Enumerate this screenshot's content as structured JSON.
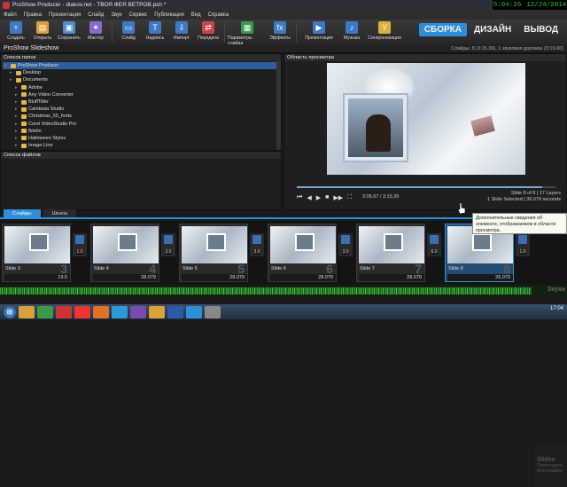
{
  "titlebar": {
    "title": "ProShow Producer - diakov.net - ТВОЯ ФЕЯ ВЕТРОВ.psh *"
  },
  "clock": {
    "time": "5:04:26",
    "date": "12/24/2014"
  },
  "menu": [
    "Файл",
    "Правка",
    "Презентация",
    "Слайд",
    "Звук",
    "Сервис",
    "Публикация",
    "Вид",
    "Справка"
  ],
  "toolbar": {
    "groups": [
      [
        {
          "label": "Создать",
          "icon": "new-icon",
          "color": "#3d79c4",
          "glyph": "+"
        },
        {
          "label": "Открыть",
          "icon": "open-icon",
          "color": "#d9a13a",
          "glyph": "▤"
        },
        {
          "label": "Сохранить",
          "icon": "save-icon",
          "color": "#4a8fd0",
          "glyph": "▣"
        },
        {
          "label": "Мастер",
          "icon": "wizard-icon",
          "color": "#8a6ad0",
          "glyph": "✦"
        }
      ],
      [
        {
          "label": "Слайд",
          "icon": "slide-icon",
          "color": "#3d79c4",
          "glyph": "▭"
        },
        {
          "label": "Надпись",
          "icon": "caption-icon",
          "color": "#3d79c4",
          "glyph": "T"
        },
        {
          "label": "Импорт",
          "icon": "import-icon",
          "color": "#3d79c4",
          "glyph": "⇩"
        },
        {
          "label": "Передача",
          "icon": "transfer-icon",
          "color": "#c44",
          "glyph": "⇄"
        }
      ],
      [
        {
          "label": "Параметры слайда",
          "icon": "slide-options-icon",
          "color": "#3a9a4a",
          "glyph": "▦"
        },
        {
          "label": "Эффекты",
          "icon": "effects-icon",
          "color": "#3d79c4",
          "glyph": "fx"
        }
      ],
      [
        {
          "label": "Презентация",
          "icon": "presentation-icon",
          "color": "#3d79c4",
          "glyph": "▶"
        },
        {
          "label": "Музыка",
          "icon": "music-icon",
          "color": "#3d79c4",
          "glyph": "♪"
        },
        {
          "label": "Синхронизация",
          "icon": "sync-icon",
          "color": "#d9b23a",
          "glyph": "Y"
        }
      ]
    ]
  },
  "modes": [
    "СБОРКА",
    "ДИЗАЙН",
    "ВЫВОД"
  ],
  "project": {
    "title": "ProShow Slideshow",
    "info": "Слайды: 8 (3:15.39), 1 звуковая дорожка (3:19.00)"
  },
  "folders": {
    "header": "Список папок",
    "items": [
      "ProShow Producer",
      "Desktop",
      "Documents",
      "Adobe",
      "Any Video Converter",
      "BluffTitler",
      "Camtasia Studio",
      "Christmas_55_fonts",
      "Corel VideoStudio Pro",
      "fbtoilo",
      "Halloween Styles",
      "Image-Line"
    ]
  },
  "files": {
    "header": "Список файлов"
  },
  "preview": {
    "header": "Область просмотра",
    "time": "3:05.67 / 3:15.39",
    "slide_info": "Slide 8 of 8  |  17 Layers",
    "slide_info2": "1 Slide Selected  |  39.079 seconds",
    "seek_progress": 0.95
  },
  "tabs": [
    "Слайды",
    "Шкала"
  ],
  "tooltip": "Дополнительные сведения об элементе, отображаемом в области просмотра.",
  "slides": [
    {
      "label": "Slide 3",
      "num": "3",
      "dur": "19.0",
      "trans": "1.0"
    },
    {
      "label": "Slide 4",
      "num": "4",
      "dur": "28.079",
      "trans": "3.0"
    },
    {
      "label": "Slide 5",
      "num": "5",
      "dur": "28.079",
      "trans": "3.0"
    },
    {
      "label": "Slide 6",
      "num": "6",
      "dur": "28.079",
      "trans": "3.0"
    },
    {
      "label": "Slide 7",
      "num": "7",
      "dur": "28.079",
      "trans": "6.0"
    },
    {
      "label": "Slide 8",
      "num": "8",
      "dur": "26.079",
      "trans": "1.0"
    }
  ],
  "slides_box": {
    "title": "Slides",
    "sub": "Перетащите фотографии"
  },
  "audio": {
    "label": "Звуки"
  },
  "taskbar": {
    "time": "17:04",
    "apps": [
      {
        "icon": "explorer-icon",
        "color": "#d9a13a"
      },
      {
        "icon": "chrome-icon",
        "color": "#3a9a4a"
      },
      {
        "icon": "opera-icon",
        "color": "#c33"
      },
      {
        "icon": "yandex-icon",
        "color": "#e33"
      },
      {
        "icon": "firefox-icon",
        "color": "#e0702a"
      },
      {
        "icon": "skype-icon",
        "color": "#2a9ad8"
      },
      {
        "icon": "media-icon",
        "color": "#7a4ab0"
      },
      {
        "icon": "folder-icon",
        "color": "#d9a13a"
      },
      {
        "icon": "word-icon",
        "color": "#2a5aa8"
      },
      {
        "icon": "proshow-icon",
        "color": "#2e8fd8"
      },
      {
        "icon": "app-icon",
        "color": "#888"
      }
    ]
  }
}
